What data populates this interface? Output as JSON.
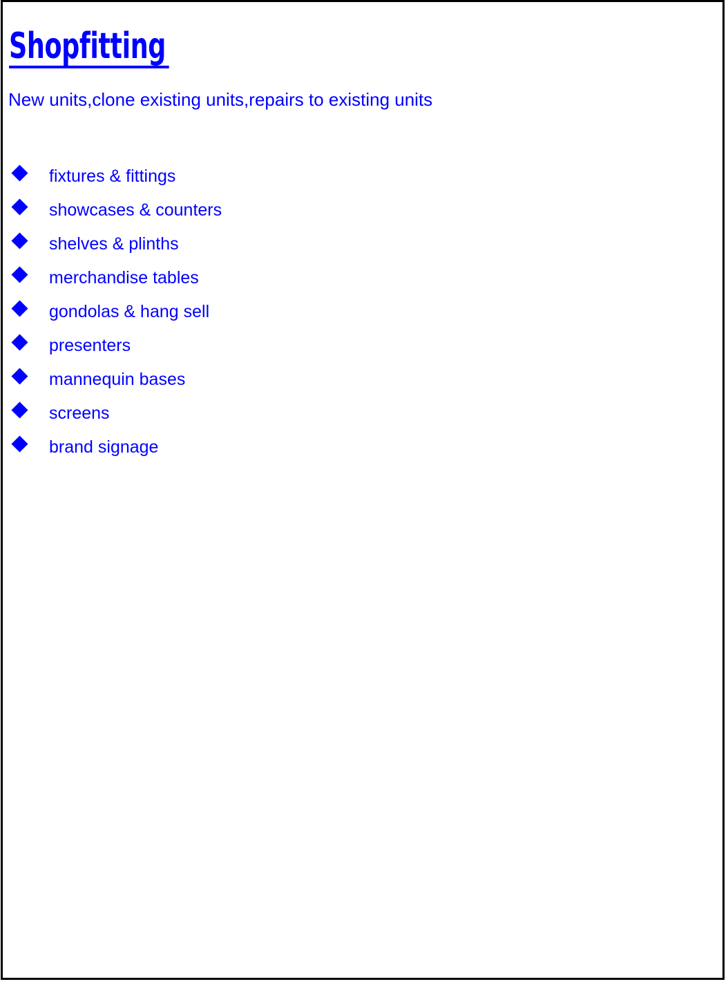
{
  "document": {
    "title": "Shopfitting",
    "subtitle": "New units,clone existing units,repairs to existing units",
    "colors": {
      "text": "#0000ff",
      "bullet": "#0000ff",
      "border": "#000000",
      "background": "#ffffff"
    }
  },
  "features": {
    "bullet_icon": "diamond-bullet-icon",
    "items": [
      {
        "label": "fixtures & fittings"
      },
      {
        "label": "showcases & counters"
      },
      {
        "label": "shelves & plinths"
      },
      {
        "label": "merchandise tables"
      },
      {
        "label": "gondolas & hang sell"
      },
      {
        "label": "presenters"
      },
      {
        "label": "mannequin bases"
      },
      {
        "label": "screens"
      },
      {
        "label": "brand signage"
      }
    ]
  }
}
